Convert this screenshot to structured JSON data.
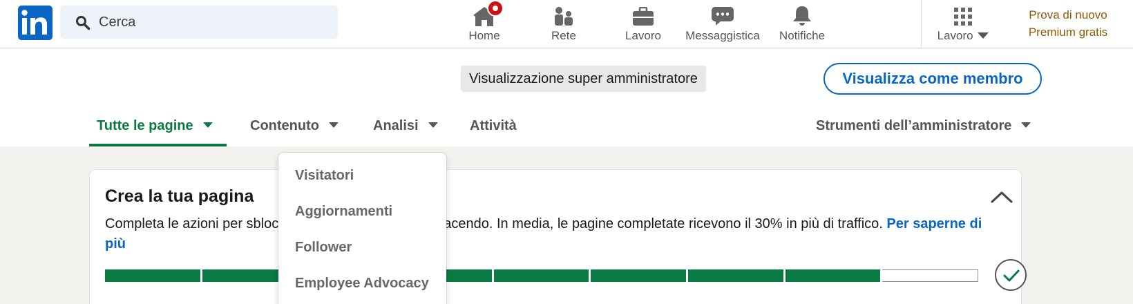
{
  "search": {
    "placeholder": "Cerca"
  },
  "nav": {
    "items": [
      {
        "label": "Home",
        "icon": "home-icon"
      },
      {
        "label": "Rete",
        "icon": "network-icon"
      },
      {
        "label": "Lavoro",
        "icon": "briefcase-icon"
      },
      {
        "label": "Messaggistica",
        "icon": "messaging-icon"
      },
      {
        "label": "Notifiche",
        "icon": "bell-icon"
      }
    ],
    "work_menu": {
      "label": "Lavoro",
      "icon": "grid-icon"
    },
    "premium": {
      "line1": "Prova di nuovo",
      "line2": "Premium gratis"
    }
  },
  "header": {
    "super_admin_label": "Visualizzazione super amministratore",
    "view_as_member_label": "Visualizza come membro",
    "tabs": [
      {
        "label": "Tutte le pagine",
        "active": true
      },
      {
        "label": "Contenuto"
      },
      {
        "label": "Analisi"
      },
      {
        "label": "Attività"
      }
    ],
    "admin_tools_label": "Strumenti dell’amministratore"
  },
  "dropdown": {
    "items": [
      "Visitatori",
      "Aggiornamenti",
      "Follower",
      "Employee Advocacy"
    ]
  },
  "card": {
    "title": "Crea la tua pagina",
    "description": "Completa le azioni per sbloccare le funzionalità strada facendo. In media, le pagine completate ricevono il 30% in più di traffico.",
    "learn_more": "Per saperne di più",
    "progress_completed_steps": 8,
    "progress_total_steps": 9
  },
  "colors": {
    "brand": "#0a66c2",
    "active_tab": "#0a7a43",
    "premium": "#915907",
    "badge": "#cc1016"
  }
}
